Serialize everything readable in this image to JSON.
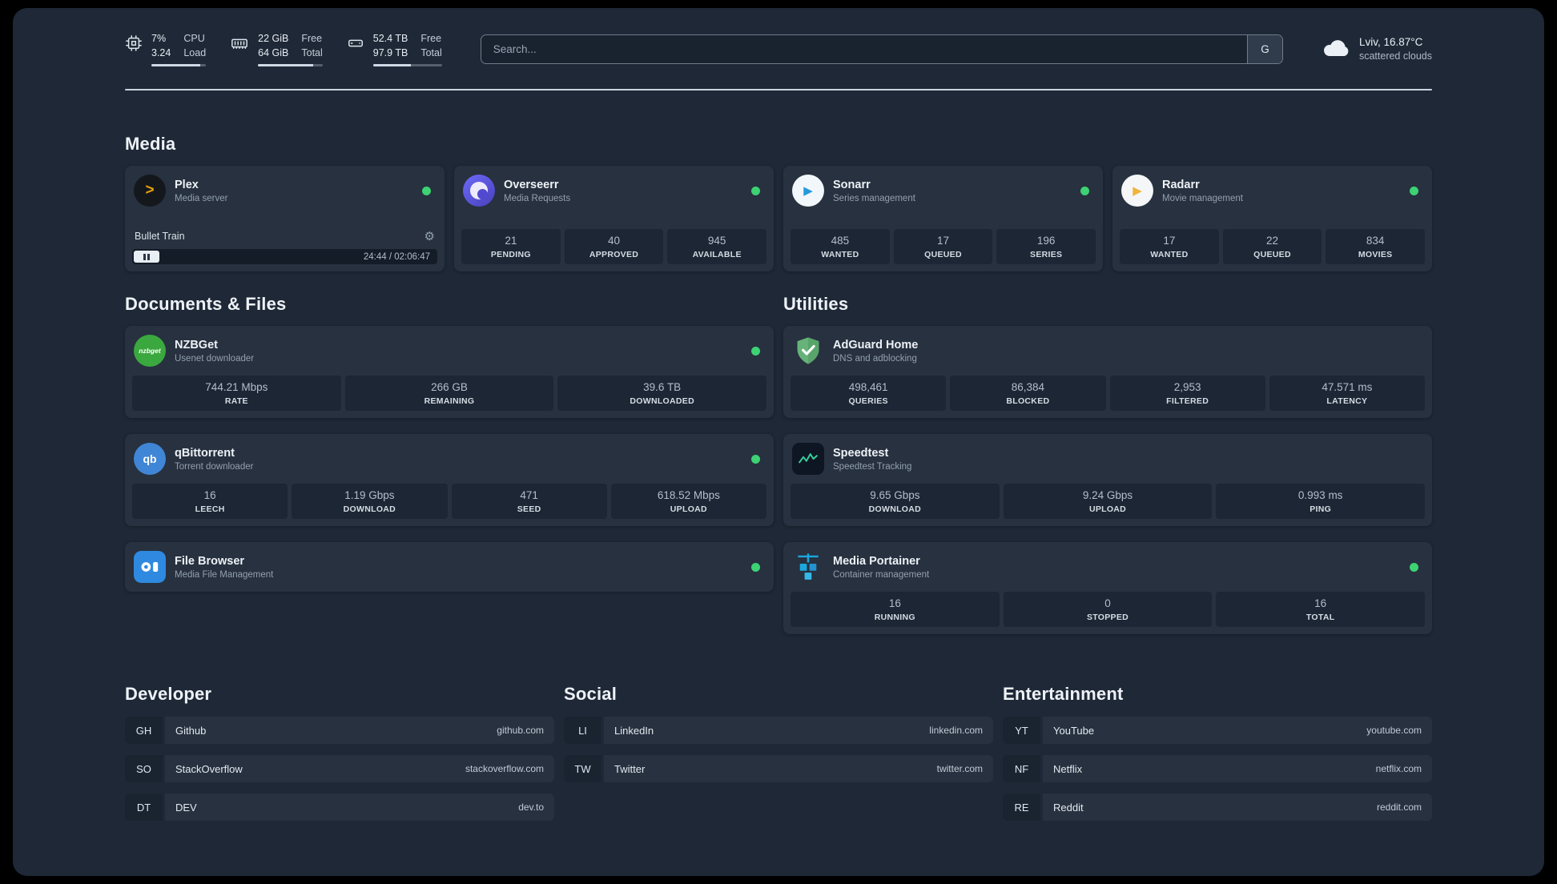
{
  "icons": {
    "gear": "⚙",
    "plex_glyph": ">",
    "sonarr_glyph": "▶",
    "radarr_glyph": "▶",
    "qbittorrent_glyph": "qb",
    "nzbget_glyph": "nzbget"
  },
  "topbar": {
    "resources": [
      {
        "icon": "cpu-icon",
        "value_1": "7%",
        "value_2": "3.24",
        "label_1": "CPU",
        "label_2": "Load",
        "meter_percent": 90
      },
      {
        "icon": "memory-icon",
        "value_1": "22 GiB",
        "value_2": "64 GiB",
        "label_1": "Free",
        "label_2": "Total",
        "meter_percent": 85
      },
      {
        "icon": "disk-icon",
        "value_1": "52.4 TB",
        "value_2": "97.9 TB",
        "label_1": "Free",
        "label_2": "Total",
        "meter_percent": 55
      }
    ],
    "search": {
      "placeholder": "Search...",
      "provider_label": "G"
    },
    "weather": {
      "location": "Lviv, 16.87°C",
      "condition": "scattered clouds"
    }
  },
  "media": {
    "title": "Media",
    "plex": {
      "name": "Plex",
      "desc": "Media server",
      "status": "online",
      "now_playing": "Bullet Train",
      "elapsed_total": "24:44 / 02:06:47"
    },
    "overseerr": {
      "name": "Overseerr",
      "desc": "Media Requests",
      "status": "online",
      "stats": [
        {
          "value": "21",
          "label": "PENDING"
        },
        {
          "value": "40",
          "label": "APPROVED"
        },
        {
          "value": "945",
          "label": "AVAILABLE"
        }
      ]
    },
    "sonarr": {
      "name": "Sonarr",
      "desc": "Series management",
      "status": "online",
      "stats": [
        {
          "value": "485",
          "label": "WANTED"
        },
        {
          "value": "17",
          "label": "QUEUED"
        },
        {
          "value": "196",
          "label": "SERIES"
        }
      ]
    },
    "radarr": {
      "name": "Radarr",
      "desc": "Movie management",
      "status": "online",
      "stats": [
        {
          "value": "17",
          "label": "WANTED"
        },
        {
          "value": "22",
          "label": "QUEUED"
        },
        {
          "value": "834",
          "label": "MOVIES"
        }
      ]
    }
  },
  "documents": {
    "title": "Documents & Files",
    "nzbget": {
      "name": "NZBGet",
      "desc": "Usenet downloader",
      "status": "online",
      "stats": [
        {
          "value": "744.21 Mbps",
          "label": "RATE"
        },
        {
          "value": "266 GB",
          "label": "REMAINING"
        },
        {
          "value": "39.6 TB",
          "label": "DOWNLOADED"
        }
      ]
    },
    "qbittorrent": {
      "name": "qBittorrent",
      "desc": "Torrent downloader",
      "status": "online",
      "stats": [
        {
          "value": "16",
          "label": "LEECH"
        },
        {
          "value": "1.19 Gbps",
          "label": "DOWNLOAD"
        },
        {
          "value": "471",
          "label": "SEED"
        },
        {
          "value": "618.52 Mbps",
          "label": "UPLOAD"
        }
      ]
    },
    "filebrowser": {
      "name": "File Browser",
      "desc": "Media File Management",
      "status": "online"
    }
  },
  "utilities": {
    "title": "Utilities",
    "adguard": {
      "name": "AdGuard Home",
      "desc": "DNS and adblocking",
      "stats": [
        {
          "value": "498,461",
          "label": "QUERIES"
        },
        {
          "value": "86,384",
          "label": "BLOCKED"
        },
        {
          "value": "2,953",
          "label": "FILTERED"
        },
        {
          "value": "47.571 ms",
          "label": "LATENCY"
        }
      ]
    },
    "speedtest": {
      "name": "Speedtest",
      "desc": "Speedtest Tracking",
      "stats": [
        {
          "value": "9.65 Gbps",
          "label": "DOWNLOAD"
        },
        {
          "value": "9.24 Gbps",
          "label": "UPLOAD"
        },
        {
          "value": "0.993 ms",
          "label": "PING"
        }
      ]
    },
    "portainer": {
      "name": "Media Portainer",
      "desc": "Container management",
      "status": "online",
      "stats": [
        {
          "value": "16",
          "label": "RUNNING"
        },
        {
          "value": "0",
          "label": "STOPPED"
        },
        {
          "value": "16",
          "label": "TOTAL"
        }
      ]
    }
  },
  "bookmarks": {
    "developer": {
      "title": "Developer",
      "items": [
        {
          "abbr": "GH",
          "name": "Github",
          "url": "github.com"
        },
        {
          "abbr": "SO",
          "name": "StackOverflow",
          "url": "stackoverflow.com"
        },
        {
          "abbr": "DT",
          "name": "DEV",
          "url": "dev.to"
        }
      ]
    },
    "social": {
      "title": "Social",
      "items": [
        {
          "abbr": "LI",
          "name": "LinkedIn",
          "url": "linkedin.com"
        },
        {
          "abbr": "TW",
          "name": "Twitter",
          "url": "twitter.com"
        }
      ]
    },
    "entertainment": {
      "title": "Entertainment",
      "items": [
        {
          "abbr": "YT",
          "name": "YouTube",
          "url": "youtube.com"
        },
        {
          "abbr": "NF",
          "name": "Netflix",
          "url": "netflix.com"
        },
        {
          "abbr": "RE",
          "name": "Reddit",
          "url": "reddit.com"
        }
      ]
    }
  },
  "colors": {
    "status_online": "#3dd273",
    "background": "#1e2836",
    "card": "#27313f"
  }
}
